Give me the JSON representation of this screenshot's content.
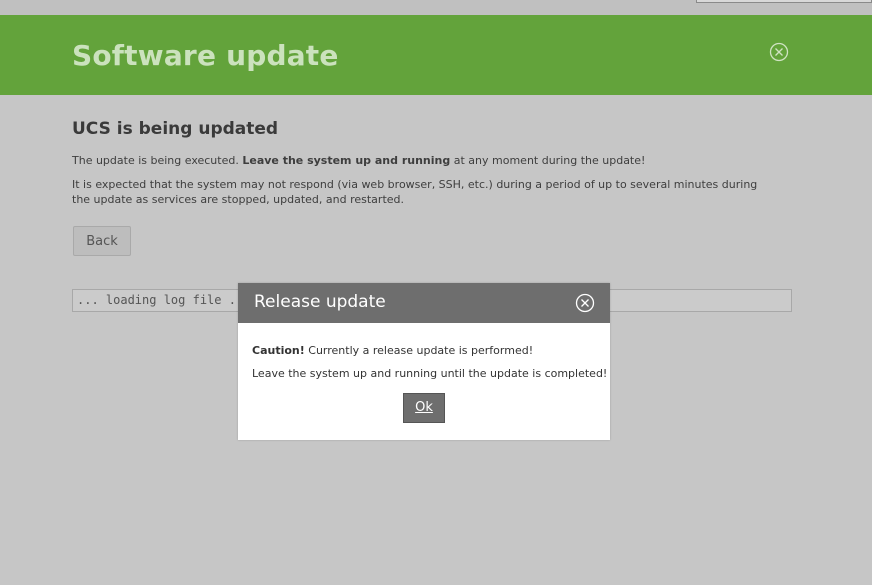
{
  "header": {
    "title": "Software update",
    "close_icon": "close-circle-icon"
  },
  "main": {
    "heading": "UCS is being updated",
    "line1_pre": "The update is being executed. ",
    "line1_bold": "Leave the system up and running",
    "line1_post": " at any moment during the update!",
    "line2": "It is expected that the system may not respond (via web browser, SSH, etc.) during a period of up to several minutes during the update as services are stopped, updated, and restarted.",
    "back_label": "Back",
    "log_text": "... loading log file ..."
  },
  "dialog": {
    "title": "Release update",
    "close_icon": "close-circle-icon",
    "caution_label": "Caution!",
    "caution_text": " Currently a release update is performed!",
    "line2": "Leave the system up and running until the update is completed!",
    "ok_label": "Ok"
  },
  "colors": {
    "header_green": "#63a33b",
    "dialog_header": "#6e6e6e",
    "overlay_gray": "#c6c6c6"
  }
}
